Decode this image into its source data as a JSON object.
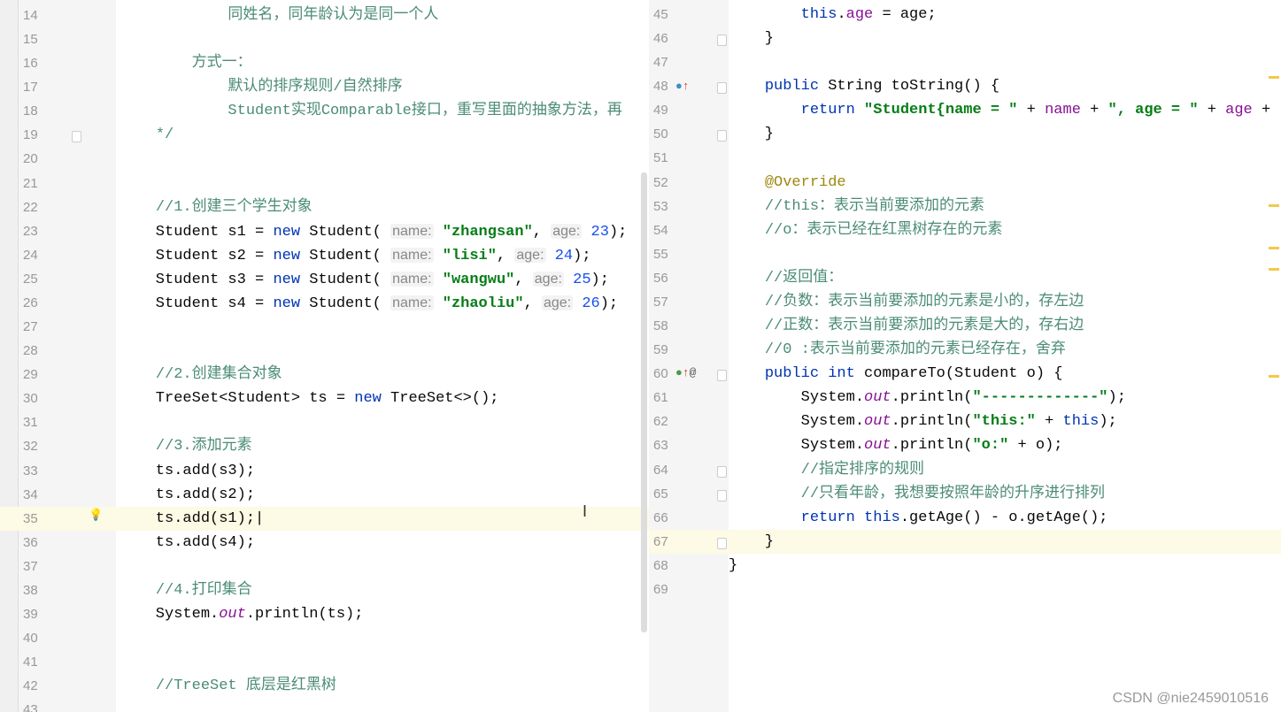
{
  "left_pane": {
    "current_line": "35",
    "lines": [
      {
        "n": "14",
        "seg": [
          [
            "            ",
            "pl"
          ],
          [
            "同姓名，同年龄认为是同一个人",
            "cm"
          ]
        ]
      },
      {
        "n": "15",
        "seg": []
      },
      {
        "n": "16",
        "seg": [
          [
            "        ",
            "pl"
          ],
          [
            "方式一：",
            "cm"
          ]
        ]
      },
      {
        "n": "17",
        "seg": [
          [
            "            ",
            "pl"
          ],
          [
            "默认的排序规则/自然排序",
            "cm"
          ]
        ]
      },
      {
        "n": "18",
        "seg": [
          [
            "            ",
            "pl"
          ],
          [
            "Student实现Comparable接口，重写里面的抽象方法，再",
            "cm"
          ]
        ]
      },
      {
        "n": "19",
        "seg": [
          [
            "    ",
            "pl"
          ],
          [
            "*/",
            "cm"
          ]
        ]
      },
      {
        "n": "20",
        "seg": []
      },
      {
        "n": "21",
        "seg": []
      },
      {
        "n": "22",
        "seg": [
          [
            "    ",
            "pl"
          ],
          [
            "//1.创建三个学生对象",
            "cm"
          ]
        ]
      },
      {
        "n": "23",
        "seg": [
          [
            "    Student s1 = ",
            "pl"
          ],
          [
            "new",
            "kw"
          ],
          [
            " Student( ",
            "pl"
          ],
          [
            "name:",
            "hint"
          ],
          [
            " ",
            "pl"
          ],
          [
            "\"zhangsan\"",
            "str"
          ],
          [
            ", ",
            "pl"
          ],
          [
            "age:",
            "hint"
          ],
          [
            " ",
            "pl"
          ],
          [
            "23",
            "num"
          ],
          [
            ");",
            "pl"
          ]
        ]
      },
      {
        "n": "24",
        "seg": [
          [
            "    Student s2 = ",
            "pl"
          ],
          [
            "new",
            "kw"
          ],
          [
            " Student( ",
            "pl"
          ],
          [
            "name:",
            "hint"
          ],
          [
            " ",
            "pl"
          ],
          [
            "\"lisi\"",
            "str"
          ],
          [
            ", ",
            "pl"
          ],
          [
            "age:",
            "hint"
          ],
          [
            " ",
            "pl"
          ],
          [
            "24",
            "num"
          ],
          [
            ");",
            "pl"
          ]
        ]
      },
      {
        "n": "25",
        "seg": [
          [
            "    Student s3 = ",
            "pl"
          ],
          [
            "new",
            "kw"
          ],
          [
            " Student( ",
            "pl"
          ],
          [
            "name:",
            "hint"
          ],
          [
            " ",
            "pl"
          ],
          [
            "\"wangwu\"",
            "str"
          ],
          [
            ", ",
            "pl"
          ],
          [
            "age:",
            "hint"
          ],
          [
            " ",
            "pl"
          ],
          [
            "25",
            "num"
          ],
          [
            ");",
            "pl"
          ]
        ]
      },
      {
        "n": "26",
        "seg": [
          [
            "    Student s4 = ",
            "pl"
          ],
          [
            "new",
            "kw"
          ],
          [
            " Student( ",
            "pl"
          ],
          [
            "name:",
            "hint"
          ],
          [
            " ",
            "pl"
          ],
          [
            "\"zhaoliu\"",
            "str"
          ],
          [
            ", ",
            "pl"
          ],
          [
            "age:",
            "hint"
          ],
          [
            " ",
            "pl"
          ],
          [
            "26",
            "num"
          ],
          [
            ");",
            "pl"
          ]
        ]
      },
      {
        "n": "27",
        "seg": []
      },
      {
        "n": "28",
        "seg": []
      },
      {
        "n": "29",
        "seg": [
          [
            "    ",
            "pl"
          ],
          [
            "//2.创建集合对象",
            "cm"
          ]
        ]
      },
      {
        "n": "30",
        "seg": [
          [
            "    TreeSet<Student> ts = ",
            "pl"
          ],
          [
            "new",
            "kw"
          ],
          [
            " TreeSet<>();",
            "pl"
          ]
        ]
      },
      {
        "n": "31",
        "seg": []
      },
      {
        "n": "32",
        "seg": [
          [
            "    ",
            "pl"
          ],
          [
            "//3.添加元素",
            "cm"
          ]
        ]
      },
      {
        "n": "33",
        "seg": [
          [
            "    ts.add(s3);",
            "pl"
          ]
        ]
      },
      {
        "n": "34",
        "seg": [
          [
            "    ts.add(s2);",
            "pl"
          ]
        ]
      },
      {
        "n": "35",
        "seg": [
          [
            "    ts.add(s1);|",
            "pl"
          ]
        ]
      },
      {
        "n": "36",
        "seg": [
          [
            "    ts.add(s4);",
            "pl"
          ]
        ]
      },
      {
        "n": "37",
        "seg": []
      },
      {
        "n": "38",
        "seg": [
          [
            "    ",
            "pl"
          ],
          [
            "//4.打印集合",
            "cm"
          ]
        ]
      },
      {
        "n": "39",
        "seg": [
          [
            "    System.",
            "pl"
          ],
          [
            "out",
            "ital"
          ],
          [
            ".println(ts);",
            "pl"
          ]
        ]
      },
      {
        "n": "40",
        "seg": []
      },
      {
        "n": "41",
        "seg": []
      },
      {
        "n": "42",
        "seg": [
          [
            "    ",
            "pl"
          ],
          [
            "//TreeSet 底层是红黑树",
            "cm"
          ]
        ]
      },
      {
        "n": "43",
        "seg": []
      }
    ]
  },
  "right_pane": {
    "current_line": "67",
    "lines": [
      {
        "n": "45",
        "seg": [
          [
            "        ",
            "pl"
          ],
          [
            "this",
            "kw"
          ],
          [
            ".",
            "pl"
          ],
          [
            "age",
            "fld"
          ],
          [
            " = age;",
            "pl"
          ]
        ]
      },
      {
        "n": "46",
        "seg": [
          [
            "    }",
            "pl"
          ]
        ]
      },
      {
        "n": "47",
        "seg": []
      },
      {
        "n": "48",
        "seg": [
          [
            "    ",
            "pl"
          ],
          [
            "public",
            "kw"
          ],
          [
            " String toString() {",
            "pl"
          ]
        ]
      },
      {
        "n": "49",
        "seg": [
          [
            "        ",
            "pl"
          ],
          [
            "return",
            "kw"
          ],
          [
            " ",
            "pl"
          ],
          [
            "\"Student{name = \"",
            "str"
          ],
          [
            " + ",
            "pl"
          ],
          [
            "name",
            "fld"
          ],
          [
            " + ",
            "pl"
          ],
          [
            "\", age = \"",
            "str"
          ],
          [
            " + ",
            "pl"
          ],
          [
            "age",
            "fld"
          ],
          [
            " +",
            "pl"
          ]
        ]
      },
      {
        "n": "50",
        "seg": [
          [
            "    }",
            "pl"
          ]
        ]
      },
      {
        "n": "51",
        "seg": []
      },
      {
        "n": "52",
        "seg": [
          [
            "    ",
            "pl"
          ],
          [
            "@Override",
            "ann"
          ]
        ]
      },
      {
        "n": "53",
        "seg": [
          [
            "    ",
            "pl"
          ],
          [
            "//this：表示当前要添加的元素",
            "cm"
          ]
        ]
      },
      {
        "n": "54",
        "seg": [
          [
            "    ",
            "pl"
          ],
          [
            "//o：表示已经在红黑树存在的元素",
            "cm"
          ]
        ]
      },
      {
        "n": "55",
        "seg": []
      },
      {
        "n": "56",
        "seg": [
          [
            "    ",
            "pl"
          ],
          [
            "//返回值：",
            "cm"
          ]
        ]
      },
      {
        "n": "57",
        "seg": [
          [
            "    ",
            "pl"
          ],
          [
            "//负数：表示当前要添加的元素是小的，存左边",
            "cm"
          ]
        ]
      },
      {
        "n": "58",
        "seg": [
          [
            "    ",
            "pl"
          ],
          [
            "//正数：表示当前要添加的元素是大的，存右边",
            "cm"
          ]
        ]
      },
      {
        "n": "59",
        "seg": [
          [
            "    ",
            "pl"
          ],
          [
            "//0 :表示当前要添加的元素已经存在，舍弃",
            "cm"
          ]
        ]
      },
      {
        "n": "60",
        "seg": [
          [
            "    ",
            "pl"
          ],
          [
            "public int",
            "kw"
          ],
          [
            " compareTo(Student o) {",
            "pl"
          ]
        ]
      },
      {
        "n": "61",
        "seg": [
          [
            "        System.",
            "pl"
          ],
          [
            "out",
            "ital"
          ],
          [
            ".println(",
            "pl"
          ],
          [
            "\"-------------\"",
            "str"
          ],
          [
            ");",
            "pl"
          ]
        ]
      },
      {
        "n": "62",
        "seg": [
          [
            "        System.",
            "pl"
          ],
          [
            "out",
            "ital"
          ],
          [
            ".println(",
            "pl"
          ],
          [
            "\"this:\"",
            "str"
          ],
          [
            " + ",
            "pl"
          ],
          [
            "this",
            "kw"
          ],
          [
            ");",
            "pl"
          ]
        ]
      },
      {
        "n": "63",
        "seg": [
          [
            "        System.",
            "pl"
          ],
          [
            "out",
            "ital"
          ],
          [
            ".println(",
            "pl"
          ],
          [
            "\"o:\"",
            "str"
          ],
          [
            " + o);",
            "pl"
          ]
        ]
      },
      {
        "n": "64",
        "seg": [
          [
            "        ",
            "pl"
          ],
          [
            "//指定排序的规则",
            "cm"
          ]
        ]
      },
      {
        "n": "65",
        "seg": [
          [
            "        ",
            "pl"
          ],
          [
            "//只看年龄，我想要按照年龄的升序进行排列",
            "cm"
          ]
        ]
      },
      {
        "n": "66",
        "seg": [
          [
            "        ",
            "pl"
          ],
          [
            "return this",
            "kw"
          ],
          [
            ".getAge() - o.getAge();",
            "pl"
          ]
        ]
      },
      {
        "n": "67",
        "seg": [
          [
            "    }",
            "pl"
          ]
        ]
      },
      {
        "n": "68",
        "seg": [
          [
            "}",
            "pl"
          ]
        ]
      },
      {
        "n": "69",
        "seg": []
      }
    ]
  },
  "gutter_icons": {
    "line_48": "override-up-icon",
    "line_60": "implements-up-at-icon",
    "line_35": "lightbulb-icon"
  },
  "watermark": "CSDN @nie2459010516",
  "colors": {
    "keyword": "#0033b3",
    "string": "#067d17",
    "comment": "#4b8c74",
    "number": "#1750eb",
    "current_line": "#fdfae5"
  }
}
